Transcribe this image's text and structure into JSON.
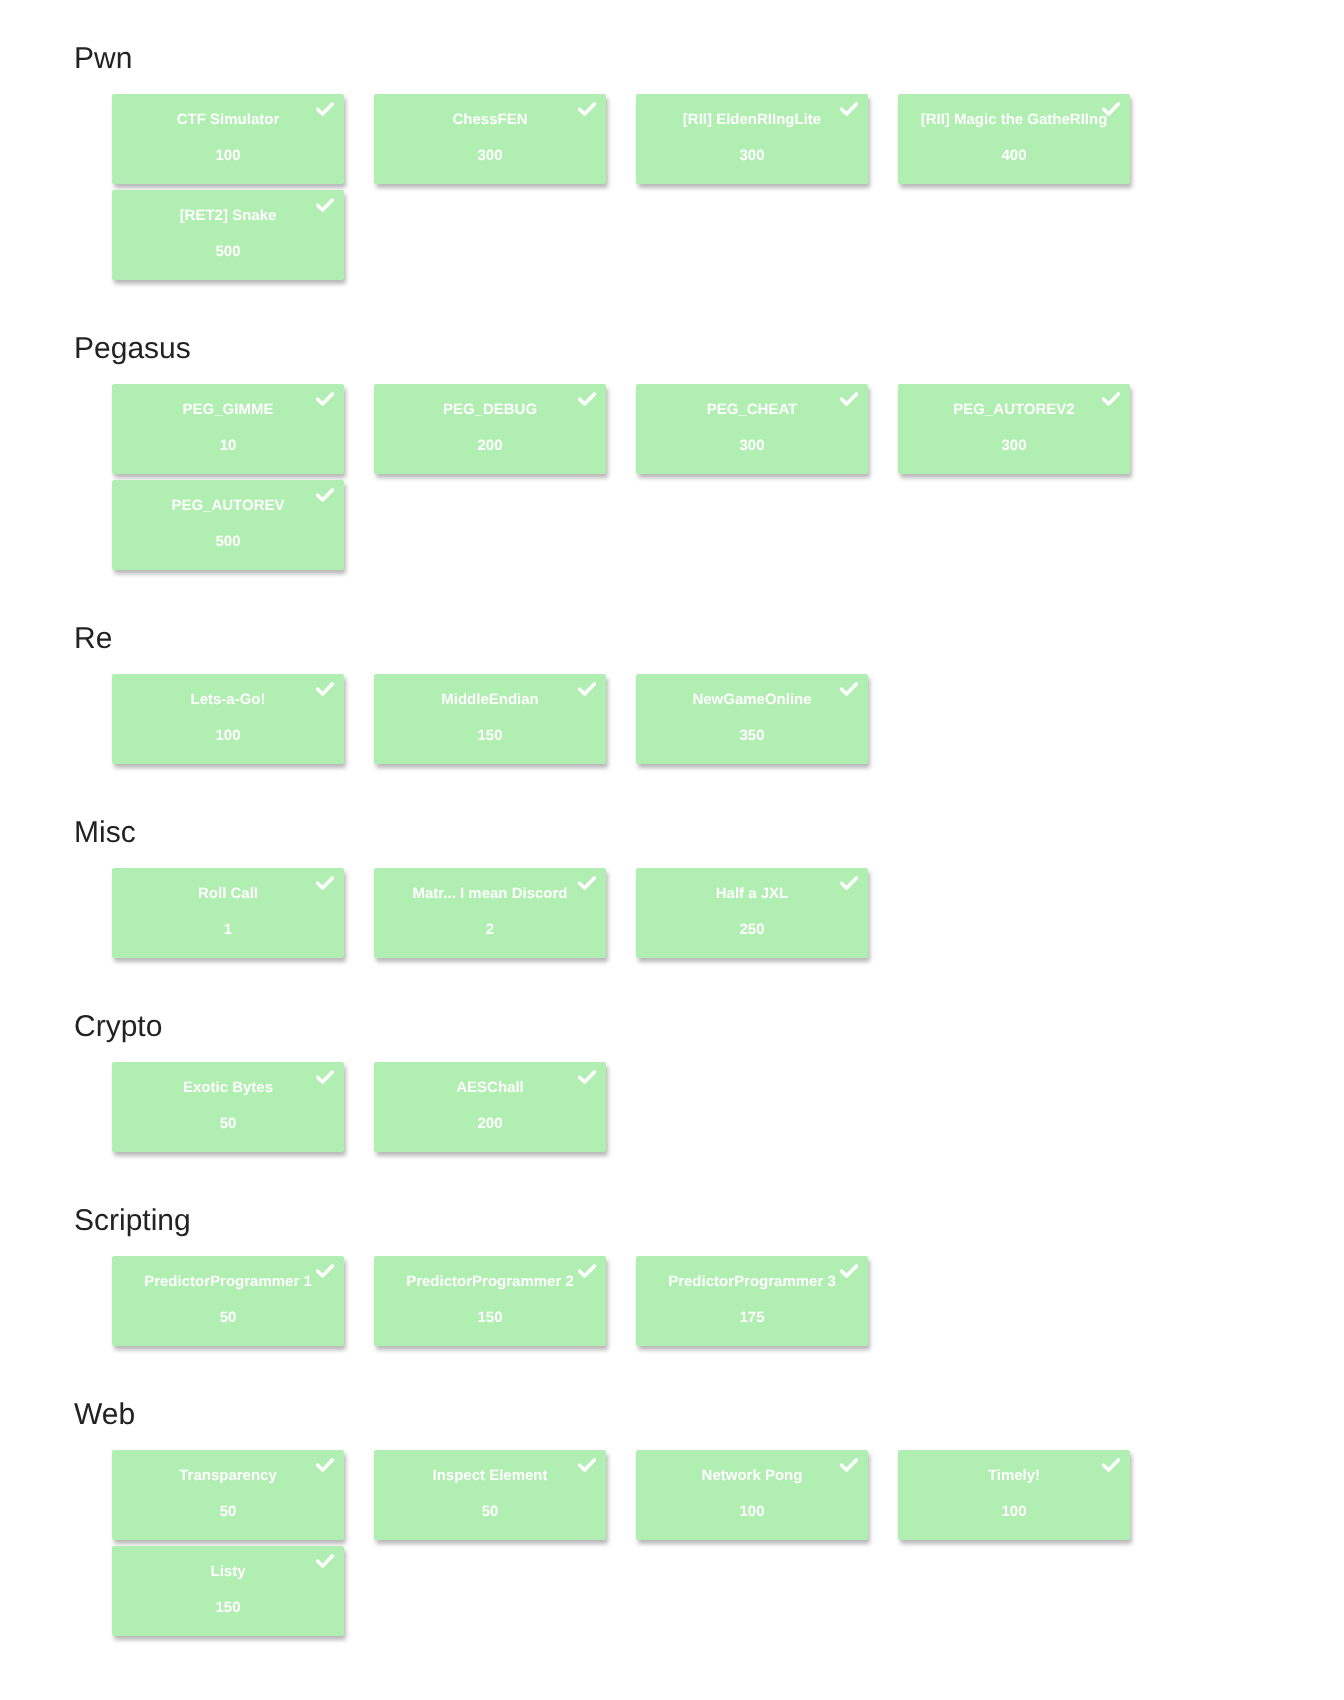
{
  "categories": [
    {
      "name": "Pwn",
      "challenges": [
        {
          "name": "CTF Simulator",
          "points": "100",
          "solved": true
        },
        {
          "name": "ChessFEN",
          "points": "300",
          "solved": true
        },
        {
          "name": "[RII] EldenRIIngLite",
          "points": "300",
          "solved": true
        },
        {
          "name": "[RII] Magic the GatheRIIng",
          "points": "400",
          "solved": true
        },
        {
          "name": "[RET2] Snake",
          "points": "500",
          "solved": true
        }
      ]
    },
    {
      "name": "Pegasus",
      "challenges": [
        {
          "name": "PEG_GIMME",
          "points": "10",
          "solved": true
        },
        {
          "name": "PEG_DEBUG",
          "points": "200",
          "solved": true
        },
        {
          "name": "PEG_CHEAT",
          "points": "300",
          "solved": true
        },
        {
          "name": "PEG_AUTOREV2",
          "points": "300",
          "solved": true
        },
        {
          "name": "PEG_AUTOREV",
          "points": "500",
          "solved": true
        }
      ]
    },
    {
      "name": "Re",
      "challenges": [
        {
          "name": "Lets-a-Go!",
          "points": "100",
          "solved": true
        },
        {
          "name": "MiddleEndian",
          "points": "150",
          "solved": true
        },
        {
          "name": "NewGameOnline",
          "points": "350",
          "solved": true
        }
      ]
    },
    {
      "name": "Misc",
      "challenges": [
        {
          "name": "Roll Call",
          "points": "1",
          "solved": true
        },
        {
          "name": "Matr... I mean Discord",
          "points": "2",
          "solved": true
        },
        {
          "name": "Half a JXL",
          "points": "250",
          "solved": true
        }
      ]
    },
    {
      "name": "Crypto",
      "challenges": [
        {
          "name": "Exotic Bytes",
          "points": "50",
          "solved": true
        },
        {
          "name": "AESChall",
          "points": "200",
          "solved": true
        }
      ]
    },
    {
      "name": "Scripting",
      "challenges": [
        {
          "name": "PredictorProgrammer 1",
          "points": "50",
          "solved": true
        },
        {
          "name": "PredictorProgrammer 2",
          "points": "150",
          "solved": true
        },
        {
          "name": "PredictorProgrammer 3",
          "points": "175",
          "solved": true
        }
      ]
    },
    {
      "name": "Web",
      "challenges": [
        {
          "name": "Transparency",
          "points": "50",
          "solved": true
        },
        {
          "name": "Inspect Element",
          "points": "50",
          "solved": true
        },
        {
          "name": "Network Pong",
          "points": "100",
          "solved": true
        },
        {
          "name": "Timely!",
          "points": "100",
          "solved": true
        },
        {
          "name": "Listy",
          "points": "150",
          "solved": true
        }
      ]
    }
  ]
}
